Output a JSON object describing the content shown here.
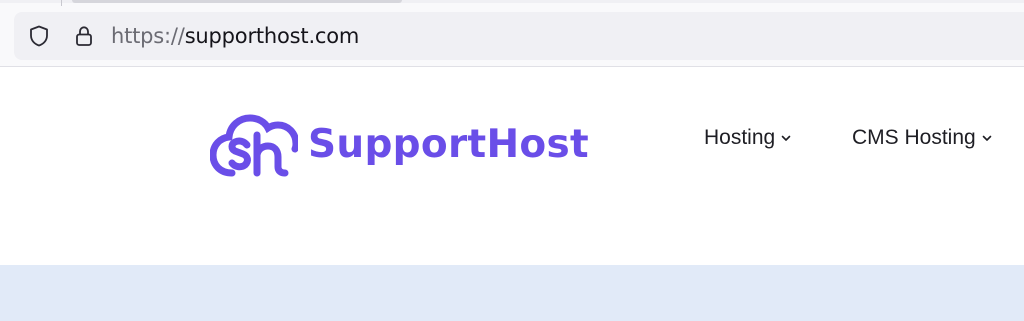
{
  "browser": {
    "url_scheme": "https://",
    "url_host": "supporthost.com",
    "icons": {
      "shield": "shield-icon",
      "lock": "lock-icon"
    }
  },
  "site": {
    "logo_text": "SupportHost",
    "brand_color": "#6a4ee8",
    "nav": [
      {
        "label": "Hosting",
        "icon": "chevron-down-icon"
      },
      {
        "label": "CMS Hosting",
        "icon": "chevron-down-icon"
      }
    ],
    "hero_band_color": "#e1eaf8"
  }
}
